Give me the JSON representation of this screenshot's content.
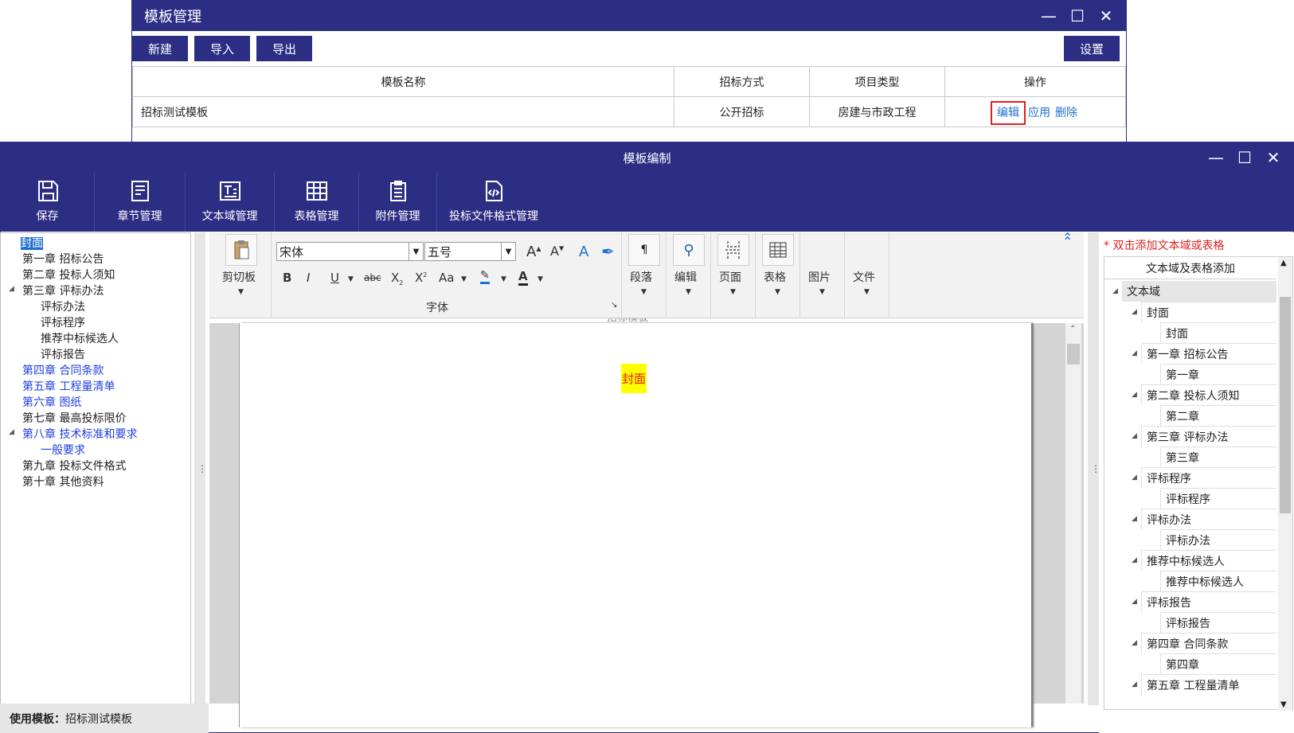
{
  "manager": {
    "title": "模板管理",
    "buttons": {
      "new": "新建",
      "import": "导入",
      "export": "导出",
      "settings": "设置"
    },
    "columns": [
      "模板名称",
      "招标方式",
      "项目类型",
      "操作"
    ],
    "row": {
      "name": "招标测试模板",
      "method": "公开招标",
      "type": "房建与市政工程"
    },
    "actions": {
      "edit": "编辑",
      "apply": "应用",
      "delete": "删除"
    }
  },
  "editor": {
    "title": "模板编制",
    "toolbar": {
      "save": "保存",
      "chapter": "章节管理",
      "textfield": "文本域管理",
      "table": "表格管理",
      "attachment": "附件管理",
      "bidformat": "投标文件格式管理"
    },
    "ribbon": {
      "clipboard": "剪切板",
      "font_name": "宋体",
      "font_size": "五号",
      "font_group": "字体",
      "paragraph": "段落",
      "edit": "编辑",
      "page": "页面",
      "table": "表格",
      "image": "图片",
      "file": "文件",
      "bold": "B",
      "italic": "I",
      "underline": "U",
      "strike": "abc",
      "case": "Aa"
    },
    "document": {
      "cover": "封面",
      "header": "招标模板"
    },
    "status": {
      "label": "使用模板：",
      "value": "招标测试模板"
    }
  },
  "tree": [
    {
      "label": "封面"
    },
    {
      "label": "第一章 招标公告"
    },
    {
      "label": "第二章 投标人须知"
    },
    {
      "label": "第三章 评标办法"
    },
    {
      "label": "评标办法"
    },
    {
      "label": "评标程序"
    },
    {
      "label": "推荐中标候选人"
    },
    {
      "label": "评标报告"
    },
    {
      "label": "第四章 合同条款"
    },
    {
      "label": "第五章 工程量清单"
    },
    {
      "label": "第六章 图纸"
    },
    {
      "label": "第七章 最高投标限价"
    },
    {
      "label": "第八章 技术标准和要求"
    },
    {
      "label": "一般要求"
    },
    {
      "label": "第九章 投标文件格式"
    },
    {
      "label": "第十章 其他资料"
    }
  ],
  "right_panel": {
    "hint": "* 双击添加文本域或表格",
    "header": "文本域及表格添加",
    "root": "文本域",
    "items": [
      {
        "label": "封面"
      },
      {
        "label": "封面"
      },
      {
        "label": "第一章 招标公告"
      },
      {
        "label": "第一章"
      },
      {
        "label": "第二章 投标人须知"
      },
      {
        "label": "第二章"
      },
      {
        "label": "第三章 评标办法"
      },
      {
        "label": "第三章"
      },
      {
        "label": "评标程序"
      },
      {
        "label": "评标程序"
      },
      {
        "label": "评标办法"
      },
      {
        "label": "评标办法"
      },
      {
        "label": "推荐中标候选人"
      },
      {
        "label": "推荐中标候选人"
      },
      {
        "label": "评标报告"
      },
      {
        "label": "评标报告"
      },
      {
        "label": "第四章 合同条款"
      },
      {
        "label": "第四章"
      },
      {
        "label": "第五章 工程量清单"
      }
    ]
  }
}
